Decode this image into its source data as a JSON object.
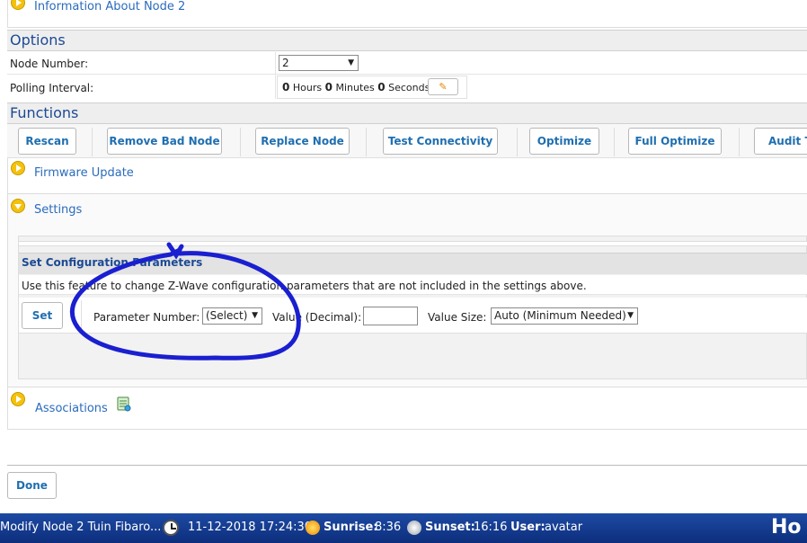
{
  "info_node": {
    "label": "Information About Node 2"
  },
  "options": {
    "title": "Options",
    "node_number": {
      "label": "Node Number:",
      "value": "2"
    },
    "polling": {
      "label": "Polling Interval:",
      "hours_value": "0",
      "hours_label": "Hours",
      "minutes_value": "0",
      "minutes_label": "Minutes",
      "seconds_value": "0",
      "seconds_label": "Seconds"
    }
  },
  "functions": {
    "title": "Functions",
    "buttons": [
      "Rescan",
      "Remove Bad Node",
      "Replace Node",
      "Test Connectivity",
      "Optimize",
      "Full Optimize",
      "Audit Th"
    ]
  },
  "firmware": {
    "label": "Firmware Update"
  },
  "settings": {
    "label": "Settings",
    "config": {
      "title": "Set Configuration Parameters",
      "description": "Use this feature to change Z-Wave configuration parameters that are not included in the settings above.",
      "set_button": "Set",
      "param_number_label": "Parameter Number:",
      "param_number_value": "(Select)",
      "value_label": "Value (Decimal):",
      "value_input": "",
      "value_size_label": "Value Size:",
      "value_size_value": "Auto (Minimum Needed)"
    }
  },
  "associations": {
    "label": "Associations"
  },
  "done_button": "Done",
  "taskbar": {
    "title": "Modify Node 2 Tuin Fibaro...",
    "datetime": "11-12-2018 17:24:30",
    "sunrise_label": "Sunrise:",
    "sunrise_value": "8:36",
    "sunset_label": "Sunset:",
    "sunset_value": "16:16",
    "user_label": "User:",
    "user_value": "avatar",
    "brand": "Ho"
  },
  "colors": {
    "accent": "#1c4a94",
    "link": "#2a6bbd",
    "annotation": "#1a1fd0",
    "taskbar": "#143c94"
  }
}
